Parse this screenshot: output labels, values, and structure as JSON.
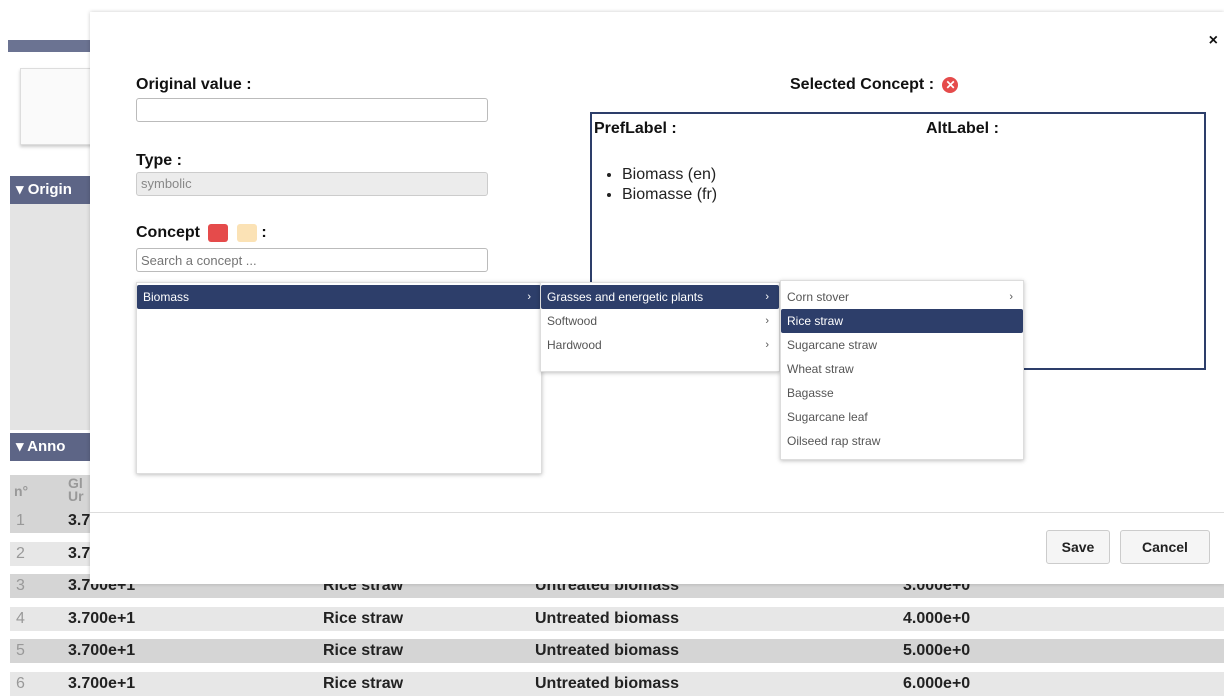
{
  "background": {
    "sections": [
      "Origin",
      "Anno"
    ],
    "table": {
      "headers": [
        "n°",
        "Gl Ur"
      ],
      "rows": [
        {
          "n": "1",
          "a": "3.7",
          "b": "",
          "c": "",
          "d": ""
        },
        {
          "n": "2",
          "a": "3.7",
          "b": "",
          "c": "",
          "d": ""
        },
        {
          "n": "3",
          "a": "3.700e+1",
          "b": "Rice straw",
          "c": "Untreated biomass",
          "d": "3.000e+0"
        },
        {
          "n": "4",
          "a": "3.700e+1",
          "b": "Rice straw",
          "c": "Untreated biomass",
          "d": "4.000e+0"
        },
        {
          "n": "5",
          "a": "3.700e+1",
          "b": "Rice straw",
          "c": "Untreated biomass",
          "d": "5.000e+0"
        },
        {
          "n": "6",
          "a": "3.700e+1",
          "b": "Rice straw",
          "c": "Untreated biomass",
          "d": "6.000e+0"
        }
      ]
    }
  },
  "modal": {
    "close_label": "×",
    "original_value_label": "Original value :",
    "original_value": "",
    "type_label": "Type :",
    "type_value": "symbolic",
    "concept_label": "Concept",
    "concept_colon": ":",
    "search_placeholder": "Search a concept ...",
    "selected_concept_label": "Selected Concept :",
    "preflabel_label": "PrefLabel :",
    "altlabel_label": "AltLabel :",
    "preflabels": [
      "Biomass (en)",
      "Biomasse (fr)"
    ],
    "save_label": "Save",
    "cancel_label": "Cancel"
  },
  "menus": {
    "level1": [
      {
        "label": "Biomass",
        "active": true,
        "has_children": true
      }
    ],
    "level2": [
      {
        "label": "Grasses and energetic plants",
        "active": true,
        "has_children": true
      },
      {
        "label": "Softwood",
        "active": false,
        "has_children": true
      },
      {
        "label": "Hardwood",
        "active": false,
        "has_children": true
      }
    ],
    "level3": [
      {
        "label": "Corn stover",
        "active": false,
        "has_children": true
      },
      {
        "label": "Rice straw",
        "active": true,
        "has_children": false
      },
      {
        "label": "Sugarcane straw",
        "active": false,
        "has_children": false
      },
      {
        "label": "Wheat straw",
        "active": false,
        "has_children": false
      },
      {
        "label": "Bagasse",
        "active": false,
        "has_children": false
      },
      {
        "label": "Sugarcane leaf",
        "active": false,
        "has_children": false
      },
      {
        "label": "Oilseed rap straw",
        "active": false,
        "has_children": false
      }
    ]
  },
  "colors": {
    "accent": "#2d3e6a",
    "section_bg": "#5d6586",
    "remove_icon": "#e54b4b"
  }
}
